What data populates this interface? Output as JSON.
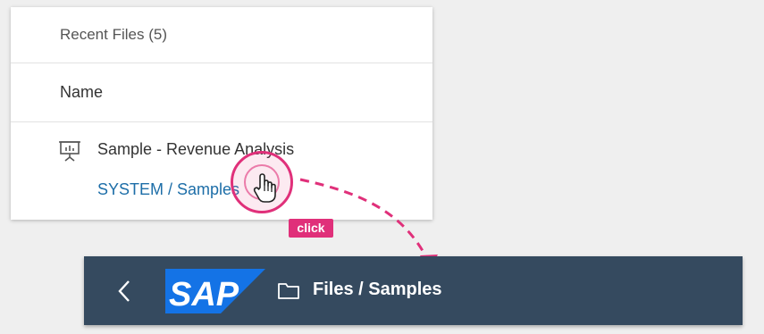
{
  "recent_files": {
    "title": "Recent Files (5)",
    "column_header": "Name",
    "items": [
      {
        "name": "Sample - Revenue Analysis",
        "path": "SYSTEM / Samples",
        "icon": "presentation-icon"
      }
    ]
  },
  "annotation": {
    "click_label": "click",
    "accent_color": "#e0307a"
  },
  "shell_bar": {
    "back_icon": "chevron-left-icon",
    "logo_text": "SAP",
    "folder_icon": "folder-icon",
    "title": "Files / Samples",
    "background_color": "#354a5f"
  },
  "colors": {
    "link": "#1d6ea8",
    "logo_blue": "#1473e6"
  }
}
